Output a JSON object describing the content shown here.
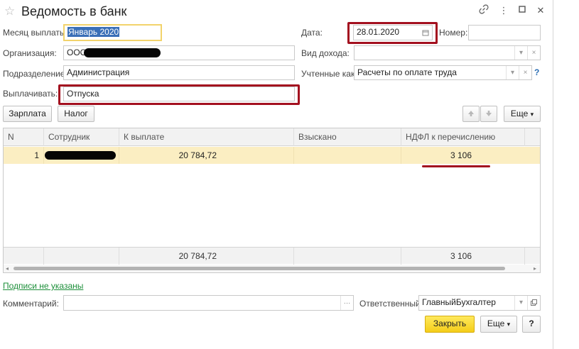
{
  "window": {
    "title": "Ведомость в банк"
  },
  "form": {
    "month_label": "Месяц выплаты:",
    "month_value": "Январь 2020",
    "org_label": "Организация:",
    "org_value": "ООО",
    "dept_label": "Подразделение:",
    "dept_value": "Администрация",
    "pay_label": "Выплачивать:",
    "pay_value": "Отпуска",
    "date_label": "Дата:",
    "date_value": "28.01.2020",
    "number_label": "Номер:",
    "number_value": "",
    "income_label": "Вид дохода:",
    "income_value": "",
    "accounted_label": "Учтенные как:",
    "accounted_value": "Расчеты по оплате труда",
    "help_glyph": "?"
  },
  "toolbar": {
    "salary_button": "Зарплата",
    "tax_button": "Налог",
    "more_button": "Еще"
  },
  "table": {
    "columns": [
      "N",
      "Сотрудник",
      "К выплате",
      "Взыскано",
      "НДФЛ к перечислению"
    ],
    "rows": [
      {
        "n": "1",
        "employee": "",
        "to_pay": "20 784,72",
        "withheld": "",
        "ndfl": "3 106"
      }
    ],
    "totals": {
      "to_pay": "20 784,72",
      "ndfl": "3 106"
    }
  },
  "footer": {
    "signatures_link": "Подписи не указаны",
    "comment_label": "Комментарий:",
    "comment_value": "",
    "responsible_label": "Ответственный:",
    "responsible_value": "ГлавныйБухгалтер",
    "close_button": "Закрыть",
    "more_button": "Еще",
    "help_button": "?"
  },
  "colors": {
    "highlight_border": "#a3101f",
    "selected_row": "#fbeec2",
    "primary_button": "#f4cd19",
    "link": "#1d8f3a"
  }
}
